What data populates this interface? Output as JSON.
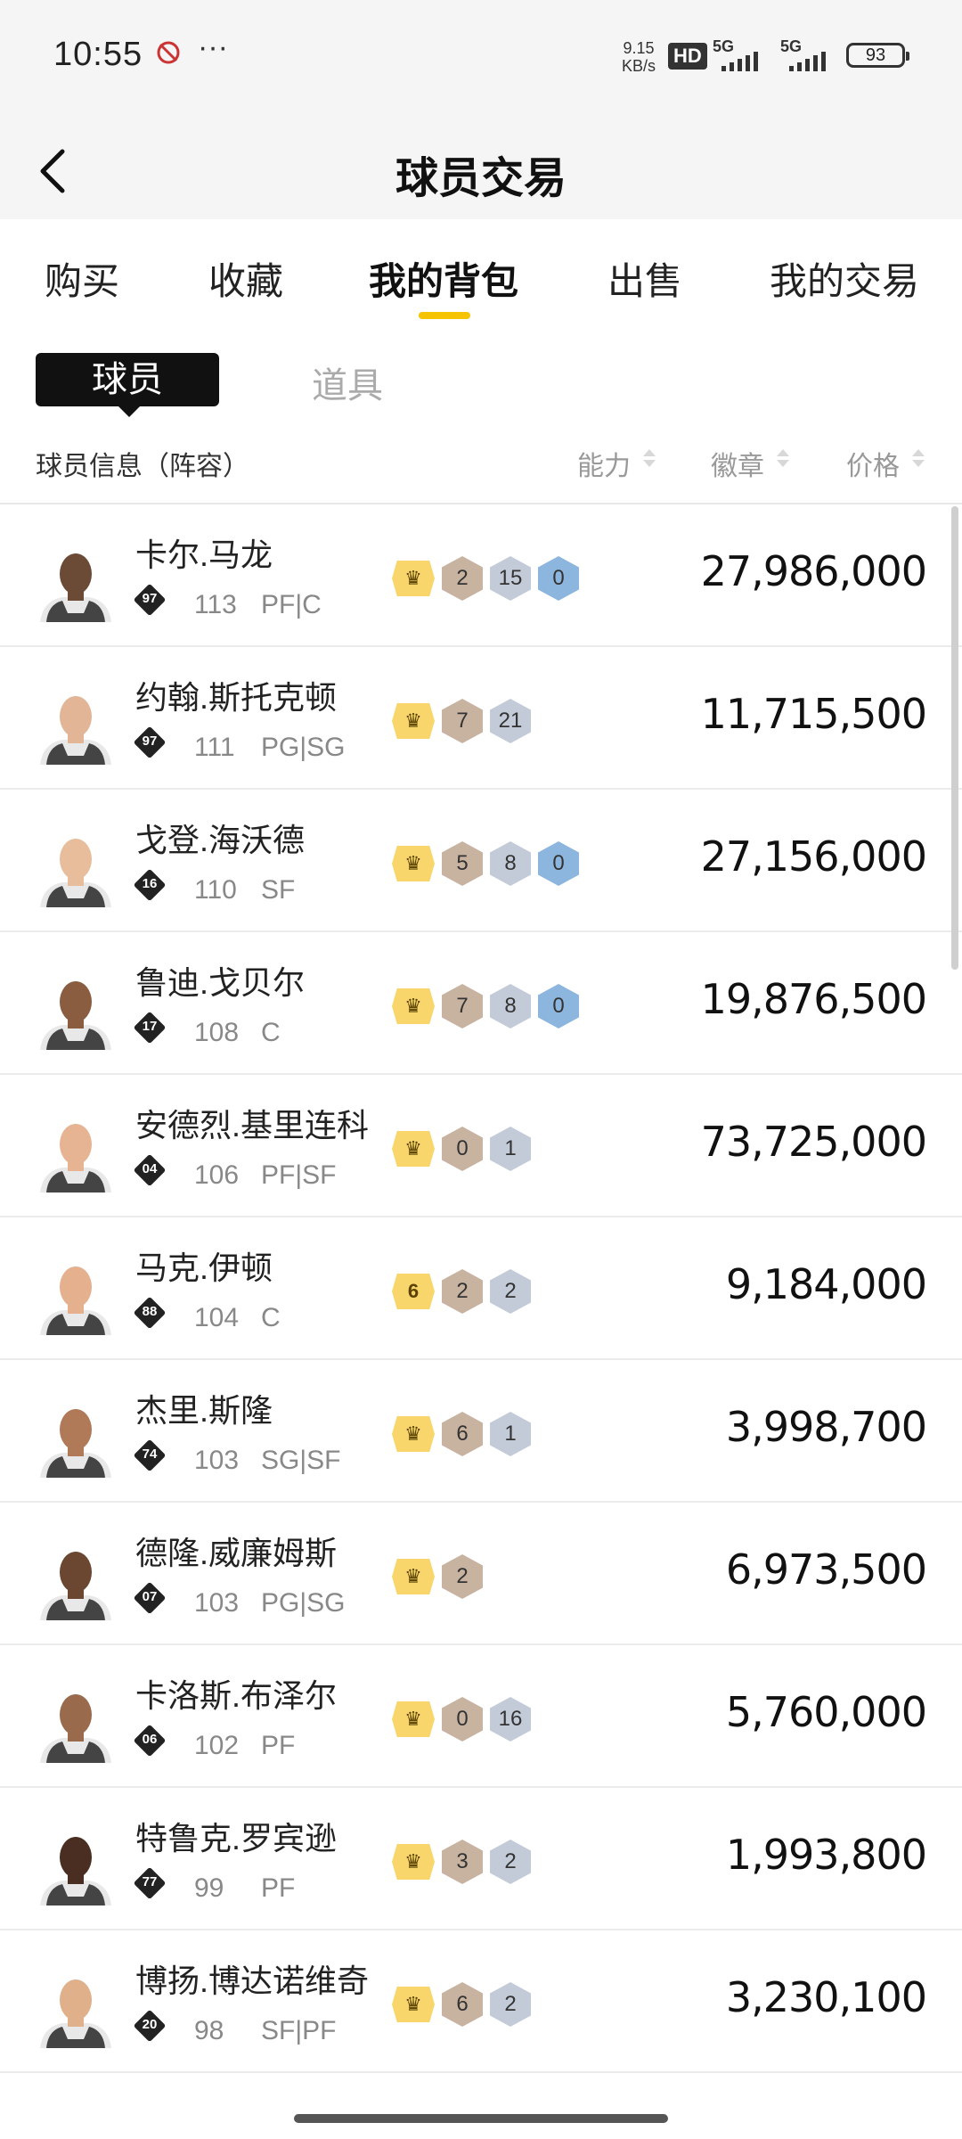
{
  "status_bar": {
    "time": "10:55",
    "net_speed_value": "9.15",
    "net_speed_unit": "KB/s",
    "hd": "HD",
    "sig1": "5G",
    "sig2": "5G",
    "battery": "93"
  },
  "header": {
    "title": "球员交易"
  },
  "tabs": [
    {
      "label": "购买"
    },
    {
      "label": "收藏"
    },
    {
      "label": "我的背包"
    },
    {
      "label": "出售"
    },
    {
      "label": "我的交易"
    }
  ],
  "subtabs": [
    {
      "label": "球员"
    },
    {
      "label": "道具"
    }
  ],
  "columns": {
    "info": "球员信息（阵容）",
    "ability": "能力",
    "badge": "徽章",
    "price": "价格"
  },
  "colors": {
    "accent": "#f5c300",
    "crown_badge": "#f8d66b",
    "bronze": "#c8b3a1",
    "silver": "#c4cbd8",
    "blue": "#8db6de"
  },
  "players": [
    {
      "name": "卡尔.马龙",
      "ovr": "97",
      "ability": "113",
      "pos": "PF|C",
      "price": "27,986,000",
      "crown": "",
      "badges": [
        {
          "v": "2",
          "c": "bronze"
        },
        {
          "v": "15",
          "c": "silver"
        },
        {
          "v": "0",
          "c": "blue"
        }
      ]
    },
    {
      "name": "约翰.斯托克顿",
      "ovr": "97",
      "ability": "111",
      "pos": "PG|SG",
      "price": "11,715,500",
      "crown": "",
      "badges": [
        {
          "v": "7",
          "c": "bronze"
        },
        {
          "v": "21",
          "c": "silver"
        }
      ]
    },
    {
      "name": "戈登.海沃德",
      "ovr": "16",
      "ability": "110",
      "pos": "SF",
      "price": "27,156,000",
      "crown": "",
      "badges": [
        {
          "v": "5",
          "c": "bronze"
        },
        {
          "v": "8",
          "c": "silver"
        },
        {
          "v": "0",
          "c": "blue"
        }
      ]
    },
    {
      "name": "鲁迪.戈贝尔",
      "ovr": "17",
      "ability": "108",
      "pos": "C",
      "price": "19,876,500",
      "crown": "",
      "badges": [
        {
          "v": "7",
          "c": "bronze"
        },
        {
          "v": "8",
          "c": "silver"
        },
        {
          "v": "0",
          "c": "blue"
        }
      ]
    },
    {
      "name": "安德烈.基里连科",
      "ovr": "04",
      "ability": "106",
      "pos": "PF|SF",
      "price": "73,725,000",
      "crown": "",
      "badges": [
        {
          "v": "0",
          "c": "bronze"
        },
        {
          "v": "1",
          "c": "silver"
        }
      ]
    },
    {
      "name": "马克.伊顿",
      "ovr": "88",
      "ability": "104",
      "pos": "C",
      "price": "9,184,000",
      "crown": "6",
      "badges": [
        {
          "v": "2",
          "c": "bronze"
        },
        {
          "v": "2",
          "c": "silver"
        }
      ]
    },
    {
      "name": "杰里.斯隆",
      "ovr": "74",
      "ability": "103",
      "pos": "SG|SF",
      "price": "3,998,700",
      "crown": "",
      "badges": [
        {
          "v": "6",
          "c": "bronze"
        },
        {
          "v": "1",
          "c": "silver"
        }
      ]
    },
    {
      "name": "德隆.威廉姆斯",
      "ovr": "07",
      "ability": "103",
      "pos": "PG|SG",
      "price": "6,973,500",
      "crown": "",
      "badges": [
        {
          "v": "2",
          "c": "bronze"
        }
      ]
    },
    {
      "name": "卡洛斯.布泽尔",
      "ovr": "06",
      "ability": "102",
      "pos": "PF",
      "price": "5,760,000",
      "crown": "",
      "badges": [
        {
          "v": "0",
          "c": "bronze"
        },
        {
          "v": "16",
          "c": "silver"
        }
      ]
    },
    {
      "name": "特鲁克.罗宾逊",
      "ovr": "77",
      "ability": "99",
      "pos": "PF",
      "price": "1,993,800",
      "crown": "",
      "badges": [
        {
          "v": "3",
          "c": "bronze"
        },
        {
          "v": "2",
          "c": "silver"
        }
      ]
    },
    {
      "name": "博扬.博达诺维奇",
      "ovr": "20",
      "ability": "98",
      "pos": "SF|PF",
      "price": "3,230,100",
      "crown": "",
      "badges": [
        {
          "v": "6",
          "c": "bronze"
        },
        {
          "v": "2",
          "c": "silver"
        }
      ]
    }
  ]
}
